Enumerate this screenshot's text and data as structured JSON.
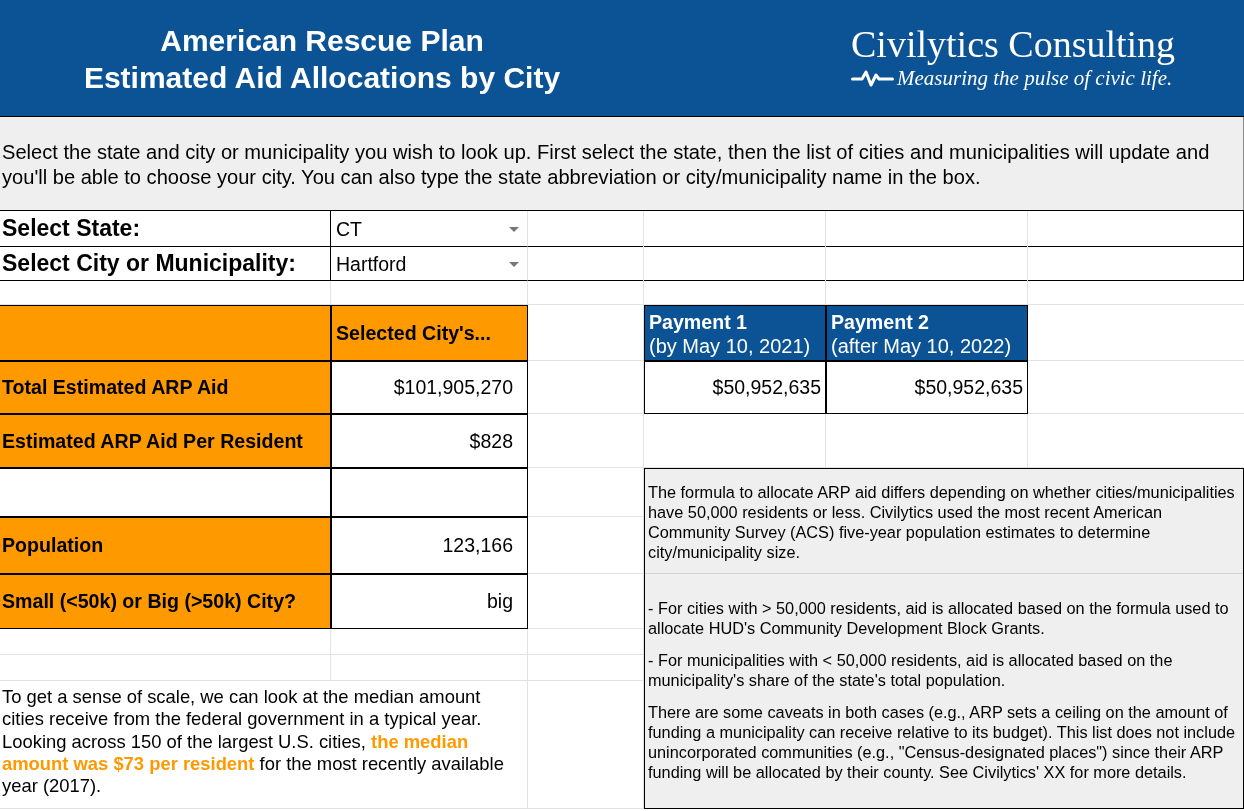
{
  "banner": {
    "title_lines": [
      "American Rescue Plan",
      "Estimated Aid Allocations by City"
    ],
    "logo": {
      "name": "Civilytics Consulting",
      "tagline": "Measuring the pulse of civic life."
    }
  },
  "instructions": "Select the state and city or municipality you wish to look up. First select the state, then the list of cities and municipalities will update and you'll be able to choose your city. You can also type the state abbreviation or city/municipality name in the box.",
  "selectors": [
    {
      "label": "Select State:",
      "value": "CT"
    },
    {
      "label": "Select City or Municipality:",
      "value": "Hartford"
    }
  ],
  "city_table": {
    "column_header": "Selected City's...",
    "rows": [
      {
        "kind": "data",
        "label": "Total Estimated ARP Aid",
        "value": "$101,905,270"
      },
      {
        "kind": "data",
        "label": "Estimated ARP Aid Per Resident",
        "value": "$828"
      },
      {
        "kind": "blank"
      },
      {
        "kind": "data",
        "label": "Population",
        "value": "123,166"
      },
      {
        "kind": "data",
        "label": "Small (<50k) or Big (>50k) City?",
        "value": "big"
      }
    ]
  },
  "payments": [
    {
      "title": "Payment 1",
      "date": "(by May 10, 2021)",
      "amount": "$50,952,635"
    },
    {
      "title": "Payment 2",
      "date": "(after May 10, 2022)",
      "amount": "$50,952,635"
    }
  ],
  "notes": {
    "sections": [
      {
        "paragraphs": [
          "The formula to allocate ARP aid differs depending on whether cities/municipalities have 50,000 residents or less. Civilytics used the most recent American Community Survey (ACS) five-year population estimates to determine city/municipality size."
        ]
      },
      {
        "paragraphs": [
          "- For cities with > 50,000 residents, aid is allocated based on the formula used to allocate HUD's Community Development Block Grants.",
          "- For municipalities with < 50,000 residents, aid is allocated based on the municipality's share of the state's total population.",
          "There are some caveats in both cases (e.g., ARP sets a ceiling on the amount of funding a municipality can receive relative to its budget). This list does not include unincorporated communities (e.g., \"Census-designated places\") since their ARP funding will be allocated by their county. See Civilytics' XX for more details."
        ]
      }
    ]
  },
  "scale_note": "To get a sense of scale, we can look at the median amount cities receive from the federal government in a typical year. Looking across 150 of the largest U.S. cities, **the median amount was $73 per resident** for the most recently available year (2017)."
}
